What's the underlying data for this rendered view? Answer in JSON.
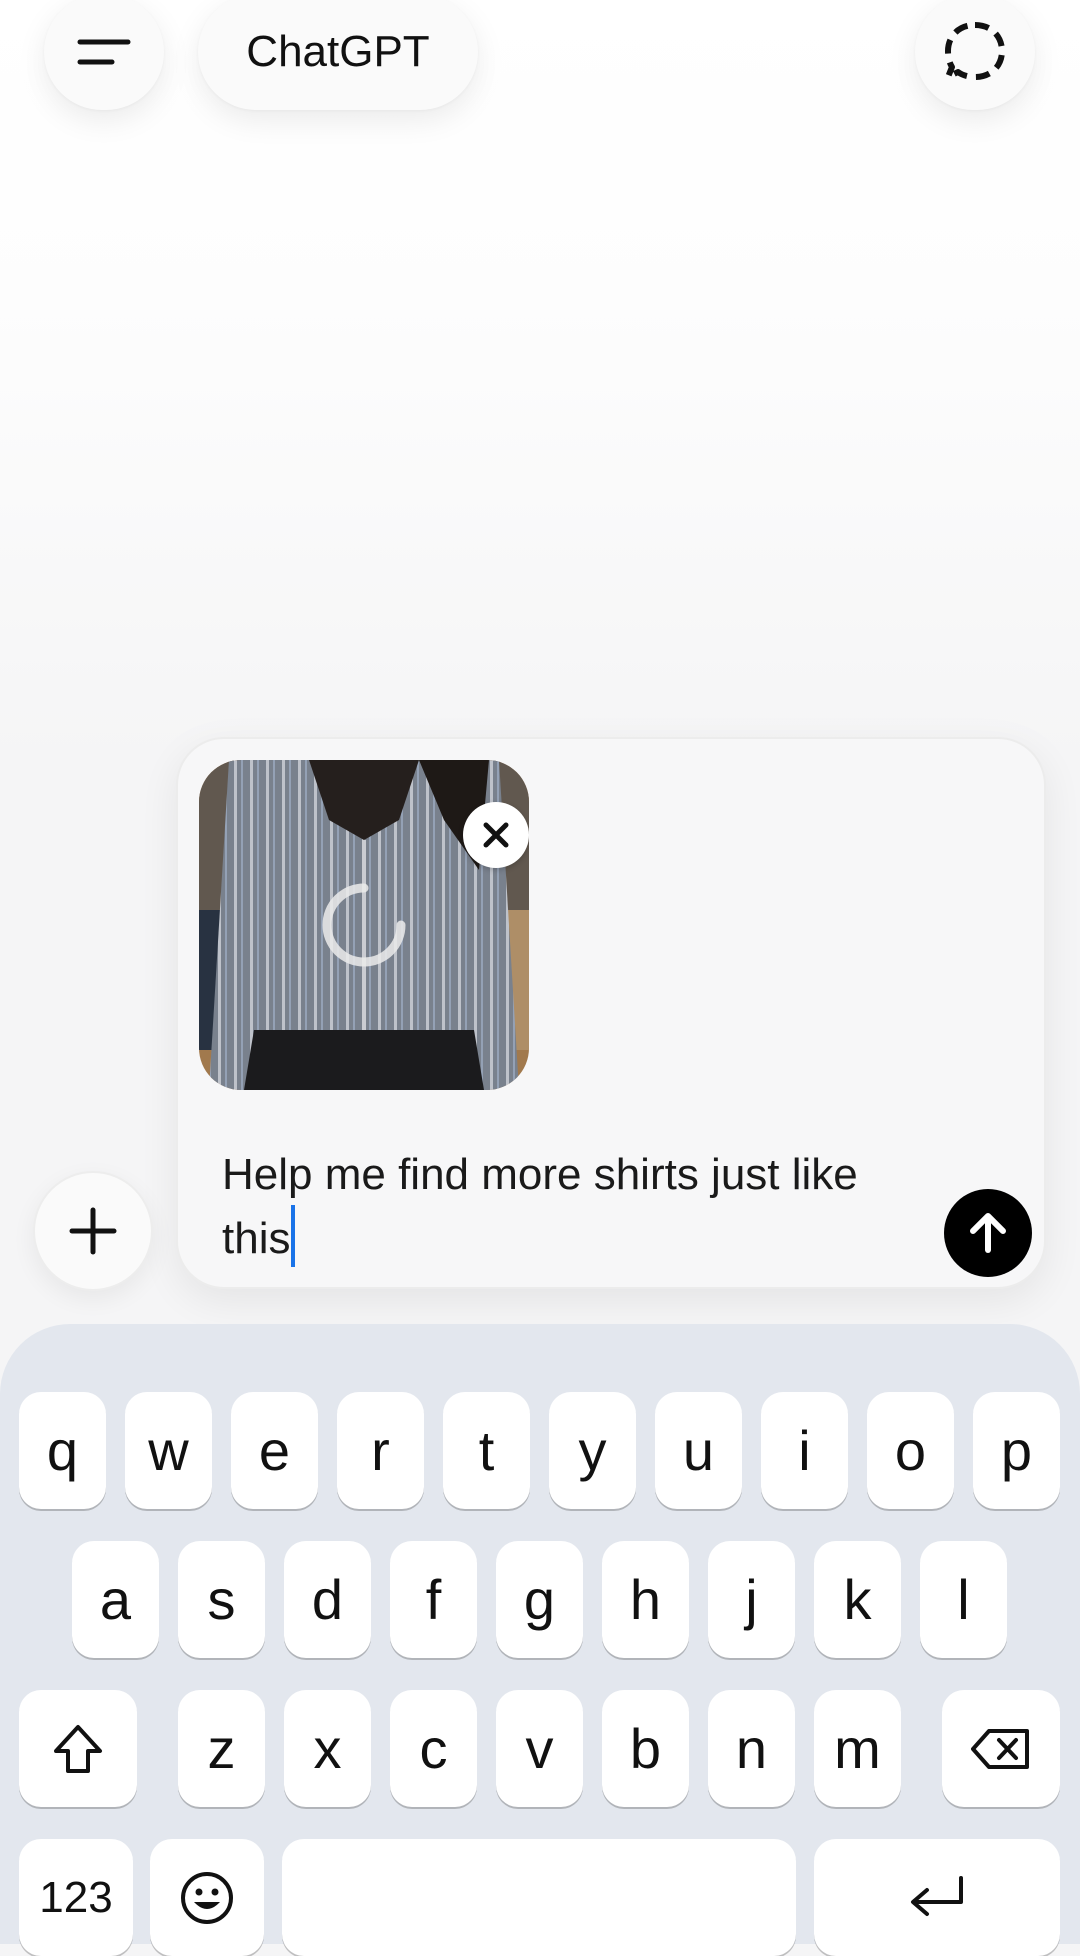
{
  "header": {
    "title": "ChatGPT",
    "menu_icon": "menu-lines-icon",
    "temporary_chat_icon": "dashed-chat-bubble-icon"
  },
  "composer": {
    "attachment": {
      "description_icon": "striped-shirt-photo",
      "status": "uploading",
      "remove_icon": "close-icon"
    },
    "prompt_value": "Help me find more shirts just like this",
    "send_icon": "arrow-up-icon",
    "add_icon": "plus-icon"
  },
  "keyboard": {
    "row1": [
      "q",
      "w",
      "e",
      "r",
      "t",
      "y",
      "u",
      "i",
      "o",
      "p"
    ],
    "row2": [
      "a",
      "s",
      "d",
      "f",
      "g",
      "h",
      "j",
      "k",
      "l"
    ],
    "row3": [
      "z",
      "x",
      "c",
      "v",
      "b",
      "n",
      "m"
    ],
    "numbers_label": "123",
    "shift_icon": "shift-arrow-icon",
    "backspace_icon": "backspace-icon",
    "emoji_icon": "emoji-icon",
    "return_icon": "return-icon"
  },
  "colors": {
    "caret": "#1a73e8",
    "send_button": "#000000",
    "keyboard_bg": "#e3e7ee"
  }
}
